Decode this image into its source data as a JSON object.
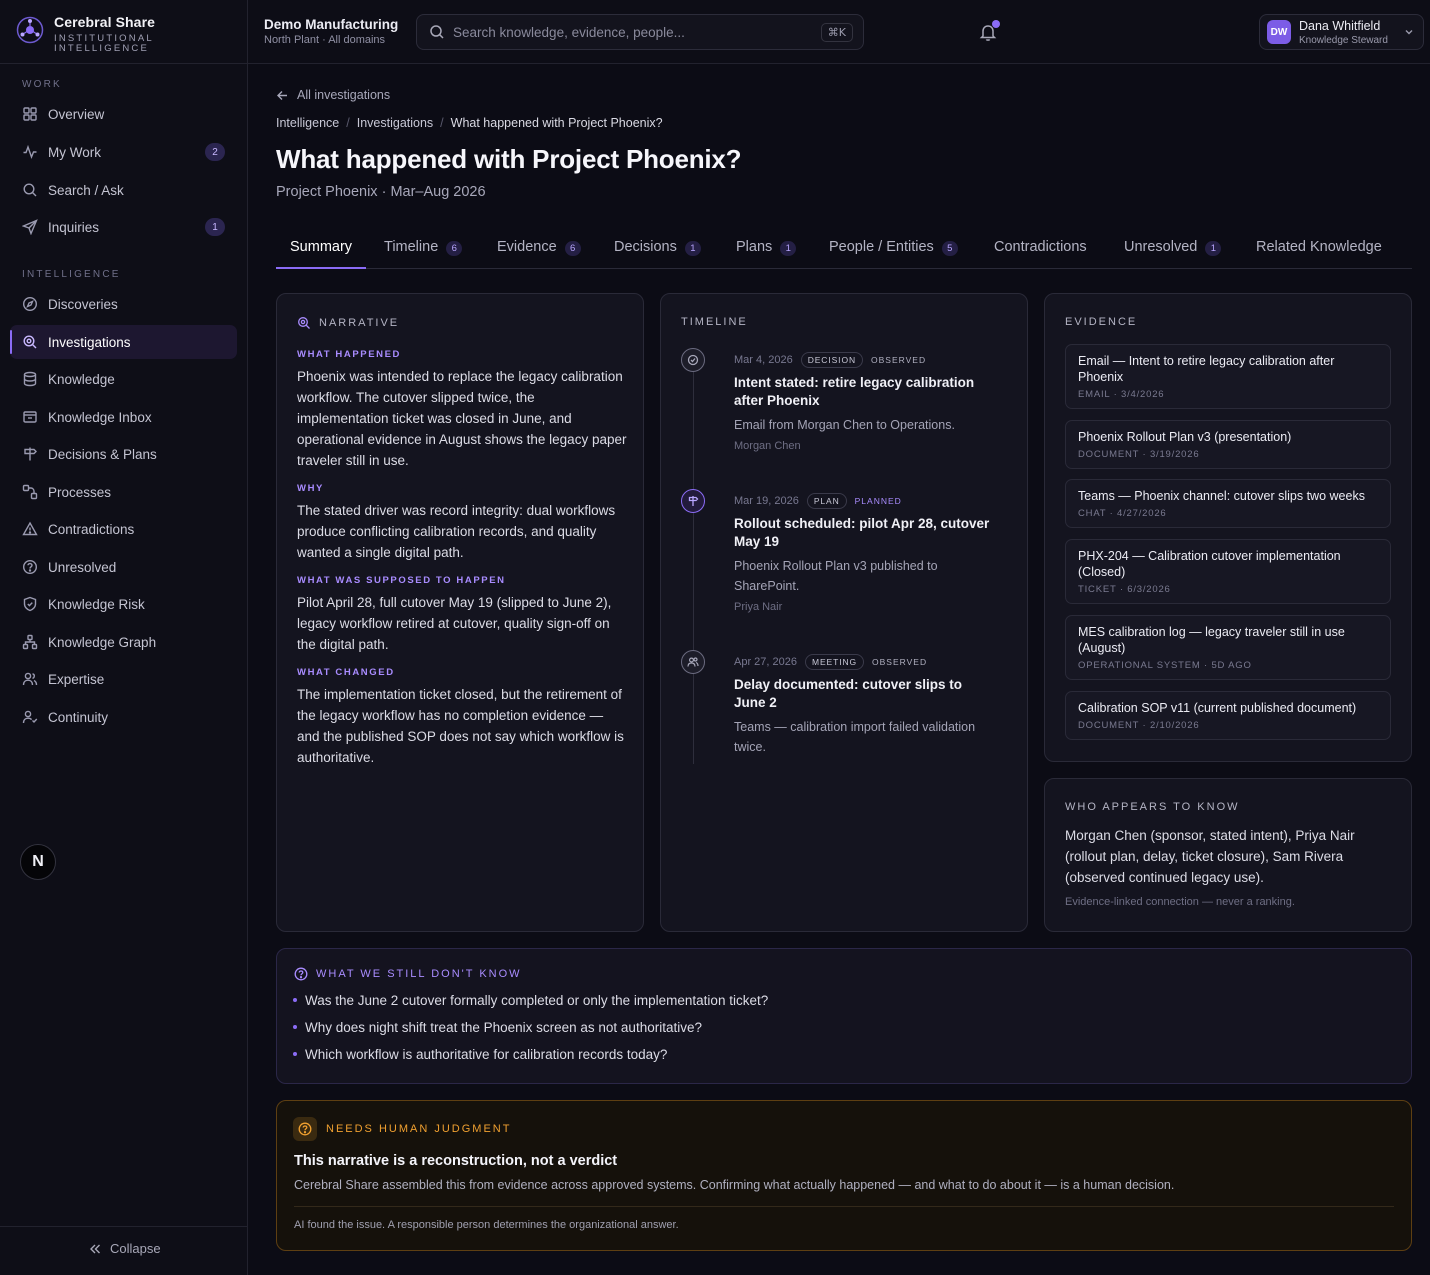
{
  "app": {
    "brand": "Cerebral Share",
    "brand_sub": "INSTITUTIONAL INTELLIGENCE",
    "accent": "#8b6cf6",
    "warn": "#f0a030"
  },
  "sidebar": {
    "work_label": "WORK",
    "intel_label": "INTELLIGENCE",
    "work_items": [
      {
        "label": "Overview",
        "icon": "grid-icon"
      },
      {
        "label": "My Work",
        "icon": "activity-icon",
        "badge": "2"
      },
      {
        "label": "Search / Ask",
        "icon": "search-icon"
      },
      {
        "label": "Inquiries",
        "icon": "send-icon",
        "badge": "1"
      }
    ],
    "intel_items": [
      {
        "label": "Discoveries",
        "icon": "compass-icon"
      },
      {
        "label": "Investigations",
        "icon": "magnifier-icon",
        "active": true
      },
      {
        "label": "Knowledge",
        "icon": "database-icon"
      },
      {
        "label": "Knowledge Inbox",
        "icon": "inbox-icon"
      },
      {
        "label": "Decisions & Plans",
        "icon": "signpost-icon"
      },
      {
        "label": "Processes",
        "icon": "workflow-icon"
      },
      {
        "label": "Contradictions",
        "icon": "warning-icon"
      },
      {
        "label": "Unresolved",
        "icon": "question-icon"
      },
      {
        "label": "Knowledge Risk",
        "icon": "shield-icon"
      },
      {
        "label": "Knowledge Graph",
        "icon": "graph-icon"
      },
      {
        "label": "Expertise",
        "icon": "people-icon"
      },
      {
        "label": "Continuity",
        "icon": "user-check-icon"
      }
    ],
    "n_badge": "N",
    "collapse_label": "Collapse"
  },
  "topbar": {
    "org_name": "Demo Manufacturing",
    "org_sub": "North Plant · All domains",
    "search_placeholder": "Search knowledge, evidence, people...",
    "shortcut": "⌘K",
    "user_initials": "DW",
    "user_name": "Dana Whitfield",
    "user_role": "Knowledge Steward"
  },
  "header": {
    "back_label": "All investigations",
    "crumbs": [
      "Intelligence",
      "Investigations",
      "What happened with Project Phoenix?"
    ],
    "title": "What happened with Project Phoenix?",
    "subtitle": "Project Phoenix · Mar–Aug 2026"
  },
  "tabs": [
    {
      "label": "Summary",
      "active": true
    },
    {
      "label": "Timeline",
      "count": "6"
    },
    {
      "label": "Evidence",
      "count": "6"
    },
    {
      "label": "Decisions",
      "count": "1"
    },
    {
      "label": "Plans",
      "count": "1"
    },
    {
      "label": "People / Entities",
      "count": "5"
    },
    {
      "label": "Contradictions"
    },
    {
      "label": "Unresolved",
      "count": "1"
    },
    {
      "label": "Related Knowledge"
    }
  ],
  "narrative": {
    "heading": "NARRATIVE",
    "sections": [
      {
        "label": "WHAT HAPPENED",
        "text": "Phoenix was intended to replace the legacy calibration workflow. The cutover slipped twice, the implementation ticket was closed in June, and operational evidence in August shows the legacy paper traveler still in use."
      },
      {
        "label": "WHY",
        "text": "The stated driver was record integrity: dual workflows produce conflicting calibration records, and quality wanted a single digital path."
      },
      {
        "label": "WHAT WAS SUPPOSED TO HAPPEN",
        "text": "Pilot April 28, full cutover May 19 (slipped to June 2), legacy workflow retired at cutover, quality sign-off on the digital path."
      },
      {
        "label": "WHAT CHANGED",
        "text": "The implementation ticket closed, but the retirement of the legacy workflow has no completion evidence — and the published SOP does not say which workflow is authoritative."
      }
    ]
  },
  "timeline": {
    "heading": "TIMELINE",
    "items": [
      {
        "date": "Mar 4, 2026",
        "type": "DECISION",
        "status": "OBSERVED",
        "title": "Intent stated: retire legacy calibration after Phoenix",
        "desc": "Email from Morgan Chen to Operations.",
        "who": "Morgan Chen"
      },
      {
        "date": "Mar 19, 2026",
        "type": "PLAN",
        "status": "PLANNED",
        "title": "Rollout scheduled: pilot Apr 28, cutover May 19",
        "desc": "Phoenix Rollout Plan v3 published to SharePoint.",
        "who": "Priya Nair"
      },
      {
        "date": "Apr 27, 2026",
        "type": "MEETING",
        "status": "OBSERVED",
        "title": "Delay documented: cutover slips to June 2",
        "desc": "Teams — calibration import failed validation twice.",
        "who": ""
      }
    ]
  },
  "evidence": {
    "heading": "EVIDENCE",
    "items": [
      {
        "title": "Email — Intent to retire legacy calibration after Phoenix",
        "meta": "EMAIL · 3/4/2026"
      },
      {
        "title": "Phoenix Rollout Plan v3 (presentation)",
        "meta": "DOCUMENT · 3/19/2026"
      },
      {
        "title": "Teams — Phoenix channel: cutover slips two weeks",
        "meta": "CHAT · 4/27/2026"
      },
      {
        "title": "PHX-204 — Calibration cutover implementation (Closed)",
        "meta": "TICKET · 6/3/2026"
      },
      {
        "title": "MES calibration log — legacy traveler still in use (August)",
        "meta": "OPERATIONAL SYSTEM · 5D AGO"
      },
      {
        "title": "Calibration SOP v11 (current published document)",
        "meta": "DOCUMENT · 2/10/2026"
      }
    ]
  },
  "who_knows": {
    "heading": "WHO APPEARS TO KNOW",
    "text": "Morgan Chen (sponsor, stated intent), Priya Nair (rollout plan, delay, ticket closure), Sam Rivera (observed continued legacy use).",
    "note": "Evidence-linked connection — never a ranking."
  },
  "dont_know": {
    "heading": "WHAT WE STILL DON'T KNOW",
    "items": [
      "Was the June 2 cutover formally completed or only the implementation ticket?",
      "Why does night shift treat the Phoenix screen as not authoritative?",
      "Which workflow is authoritative for calibration records today?"
    ]
  },
  "judgment": {
    "label": "NEEDS HUMAN JUDGMENT",
    "title": "This narrative is a reconstruction, not a verdict",
    "body": "Cerebral Share assembled this from evidence across approved systems. Confirming what actually happened — and what to do about it — is a human decision.",
    "footer": "AI found the issue. A responsible person determines the organizational answer."
  }
}
